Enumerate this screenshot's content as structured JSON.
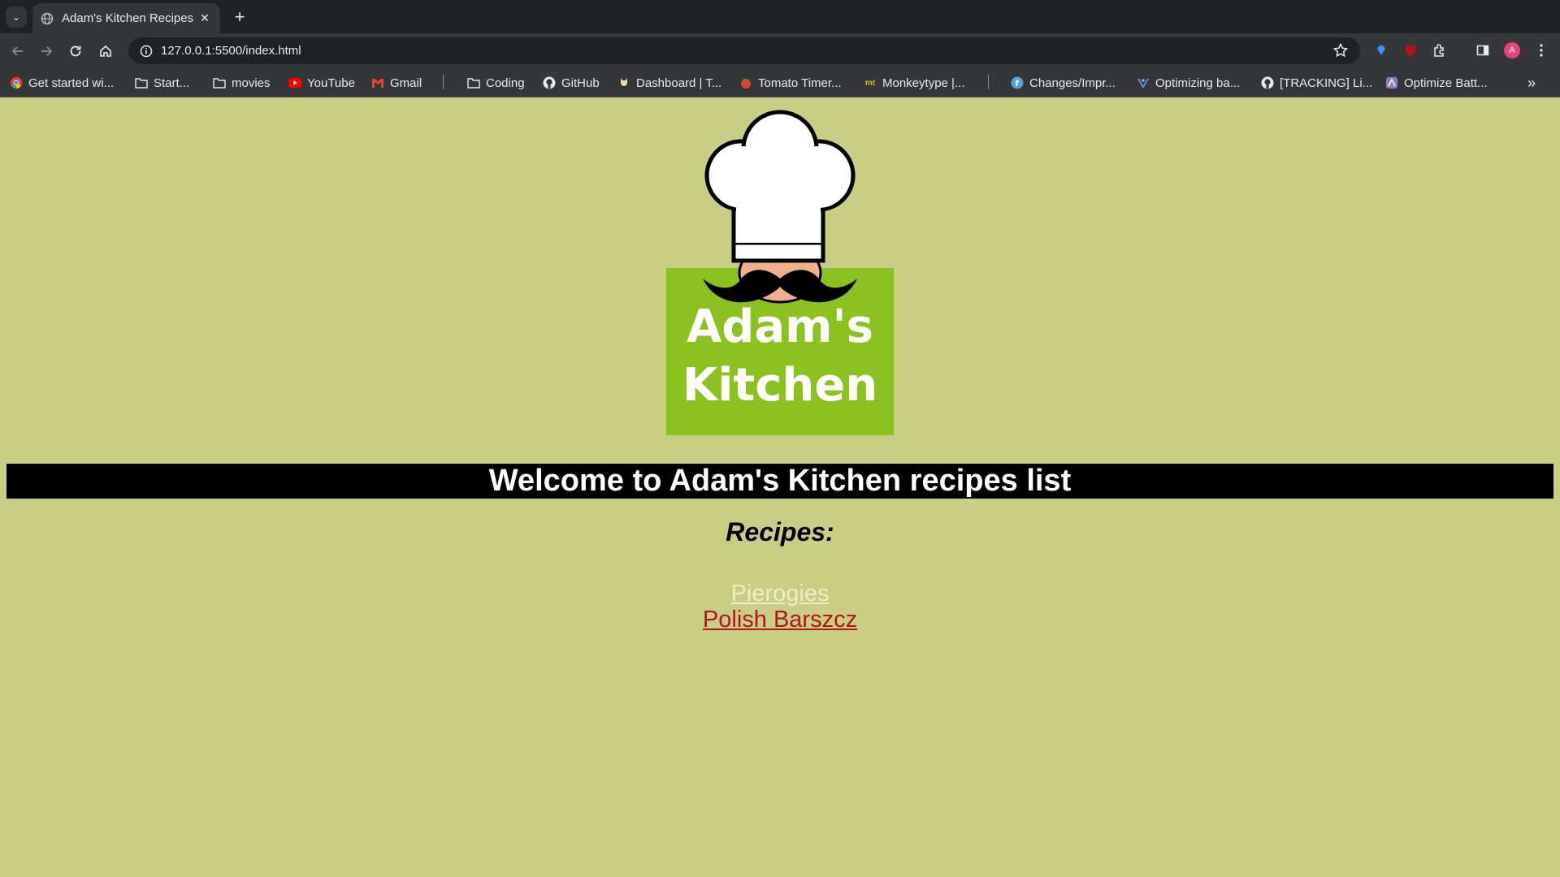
{
  "browser": {
    "tab": {
      "title": "Adam's Kitchen Recipes"
    },
    "address_bar": {
      "url": "127.0.0.1:5500/index.html"
    },
    "profile_initial": "A",
    "bookmarks": [
      {
        "label": "Get started wi...",
        "icon": "chrome-icon"
      },
      {
        "label": "Start...",
        "icon": "folder-icon"
      },
      {
        "label": "movies",
        "icon": "folder-icon"
      },
      {
        "label": "YouTube",
        "icon": "youtube-icon"
      },
      {
        "label": "Gmail",
        "icon": "gmail-icon"
      },
      {
        "label": "Coding",
        "icon": "folder-icon"
      },
      {
        "label": "GitHub",
        "icon": "github-icon"
      },
      {
        "label": "Dashboard | T...",
        "icon": "dashboard-icon"
      },
      {
        "label": "Tomato Timer...",
        "icon": "tomato-icon"
      },
      {
        "label": "Monkeytype |...",
        "icon": "monkeytype-icon"
      },
      {
        "label": "Changes/Impr...",
        "icon": "fedora-icon"
      },
      {
        "label": "Optimizing ba...",
        "icon": "bookmark-site-icon"
      },
      {
        "label": "[TRACKING] Li...",
        "icon": "github-icon"
      },
      {
        "label": "Optimize Batt...",
        "icon": "bookmark-site-icon"
      }
    ]
  },
  "page": {
    "logo": {
      "line1": "Adam's",
      "line2": "Kitchen"
    },
    "banner": "Welcome to Adam's Kitchen recipes list",
    "recipes_heading": "Recipes:",
    "recipes": [
      {
        "label": "Pierogies",
        "state": "visited"
      },
      {
        "label": "Polish Barszcz",
        "state": "unvisited"
      }
    ]
  },
  "colors": {
    "page_background": "#c8cf84",
    "logo_green": "#8cc21f",
    "banner_background": "#000000",
    "visited_link": "#f2ecc8",
    "unvisited_link": "#b5121b"
  }
}
